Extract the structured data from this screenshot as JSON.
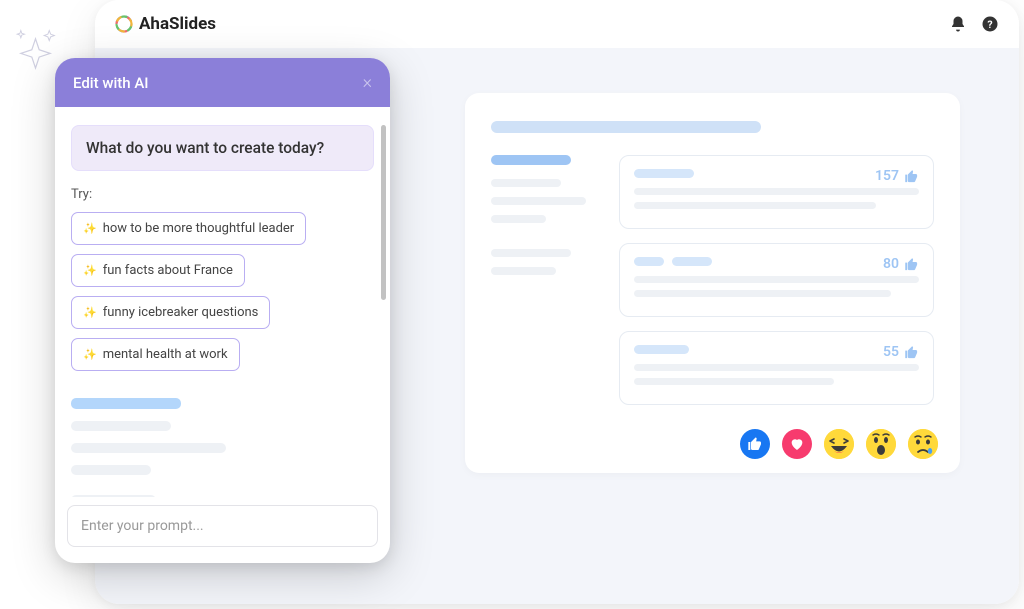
{
  "brand": {
    "name": "AhaSlides"
  },
  "aiPanel": {
    "title": "Edit with AI",
    "question": "What do you want to create today?",
    "tryLabel": "Try:",
    "suggestions": [
      "how to be more thoughtful leader",
      "fun facts about France",
      "funny icebreaker questions",
      "mental health at work"
    ],
    "inputPlaceholder": "Enter your prompt..."
  },
  "slidePreview": {
    "results": [
      {
        "votes": 157
      },
      {
        "votes": 80
      },
      {
        "votes": 55
      }
    ]
  },
  "reactions": {
    "like": "like",
    "love": "love",
    "haha": "haha",
    "wow": "wow",
    "sad": "sad"
  }
}
